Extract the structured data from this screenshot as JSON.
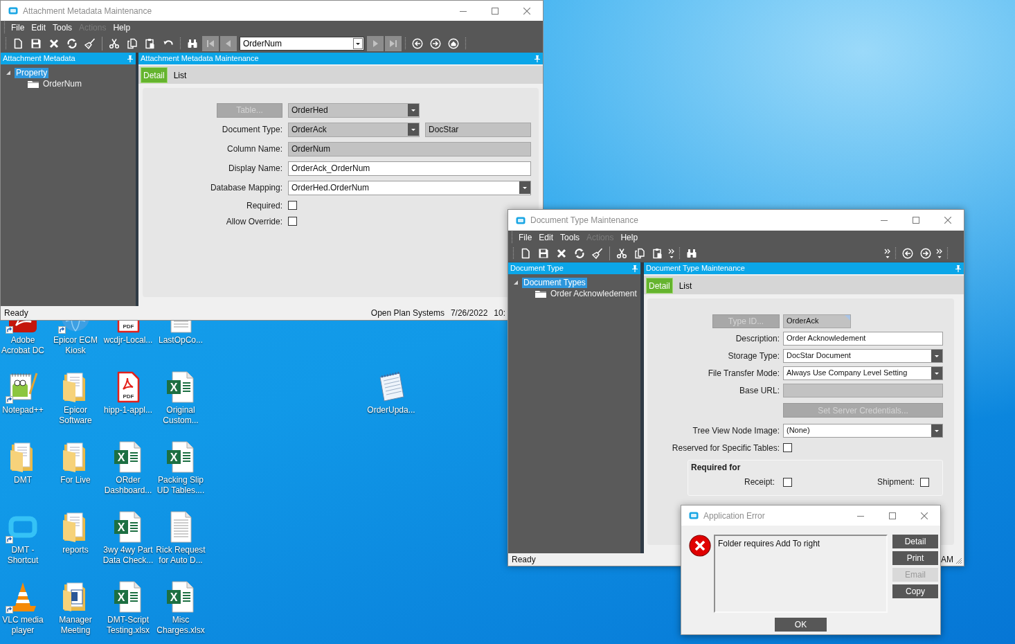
{
  "desktop": {
    "icons": [
      {
        "label": "Adobe Acrobat DC",
        "kind": "acrobat",
        "shortcut": true
      },
      {
        "label": "Epicor ECM Kiosk",
        "kind": "globe",
        "shortcut": true
      },
      {
        "label": "wcdjr-Local...",
        "kind": "pdf",
        "badge": "PDF",
        "shortcut": false
      },
      {
        "label": "LastOpCo...",
        "kind": "text",
        "shortcut": false
      },
      {
        "label": "Notepad++",
        "kind": "notepad",
        "shortcut": true
      },
      {
        "label": "Epicor Software",
        "kind": "folder",
        "shortcut": false
      },
      {
        "label": "hipp-1-appl...",
        "kind": "pdf",
        "badge": "PDF",
        "shortcut": false
      },
      {
        "label": "Original Custom...",
        "kind": "excel",
        "badge": "X",
        "shortcut": false
      },
      {
        "label": "DMT",
        "kind": "folder",
        "shortcut": false
      },
      {
        "label": "For Live",
        "kind": "folder",
        "shortcut": false
      },
      {
        "label": "ORder Dashboard...",
        "kind": "excel",
        "badge": "X",
        "shortcut": false
      },
      {
        "label": "Packing Slip UD Tables....",
        "kind": "excel",
        "badge": "X",
        "shortcut": false
      },
      {
        "label": "DMT - Shortcut",
        "kind": "app",
        "shortcut": true
      },
      {
        "label": "reports",
        "kind": "folder",
        "shortcut": false
      },
      {
        "label": "3wy 4wy Part Data Check...",
        "kind": "excel",
        "badge": "X",
        "shortcut": false
      },
      {
        "label": "Rick Request for Auto D...",
        "kind": "text",
        "shortcut": false
      },
      {
        "label": "VLC media player",
        "kind": "cone",
        "shortcut": true
      },
      {
        "label": "Manager Meeting",
        "kind": "folder_doc",
        "shortcut": false
      },
      {
        "label": "DMT-Script Testing.xlsx",
        "kind": "excel",
        "badge": "X",
        "shortcut": false
      },
      {
        "label": "Misc Charges.xlsx",
        "kind": "excel",
        "badge": "X",
        "shortcut": false
      }
    ],
    "loose_icons": [
      {
        "label": "OrderUpda...",
        "kind": "notepad_doc",
        "shortcut": false
      }
    ]
  },
  "attachment_window": {
    "title": "Attachment Metadata Maintenance",
    "menu": [
      {
        "label": "File",
        "disabled": false
      },
      {
        "label": "Edit",
        "disabled": false
      },
      {
        "label": "Tools",
        "disabled": false
      },
      {
        "label": "Actions",
        "disabled": true
      },
      {
        "label": "Help",
        "disabled": false
      }
    ],
    "toolbar": [
      {
        "kind": "grip"
      },
      {
        "kind": "new",
        "disabled": false
      },
      {
        "kind": "save",
        "disabled": false
      },
      {
        "kind": "delete",
        "disabled": false
      },
      {
        "kind": "refresh",
        "disabled": false
      },
      {
        "kind": "clear",
        "disabled": false
      },
      {
        "kind": "separator"
      },
      {
        "kind": "cut",
        "disabled": false
      },
      {
        "kind": "copy",
        "disabled": false
      },
      {
        "kind": "paste",
        "disabled": false
      },
      {
        "kind": "undo",
        "disabled": false
      },
      {
        "kind": "grip"
      },
      {
        "kind": "find",
        "disabled": false
      },
      {
        "kind": "first",
        "disabled": true
      },
      {
        "kind": "prev",
        "disabled": true
      },
      {
        "kind": "combo",
        "value": "OrderNum"
      },
      {
        "kind": "next",
        "disabled": true
      },
      {
        "kind": "last",
        "disabled": true
      },
      {
        "kind": "grip"
      },
      {
        "kind": "back",
        "disabled": false
      },
      {
        "kind": "forward",
        "disabled": false
      },
      {
        "kind": "home",
        "disabled": false
      },
      {
        "kind": "grip"
      }
    ],
    "tree_pane": {
      "title": "Attachment Metadata",
      "tree": [
        {
          "label": "Property",
          "selected": true,
          "expanded": true,
          "children": [
            {
              "label": "OrderNum",
              "selected": false
            }
          ]
        }
      ]
    },
    "main_pane": {
      "title": "Attachment Metadata Maintenance",
      "tabs": [
        {
          "label": "Detail",
          "selected": true
        },
        {
          "label": "List",
          "selected": false
        }
      ],
      "form": {
        "rows": [
          {
            "kind": "button_field",
            "button": {
              "label": "Table...",
              "disabled": true
            },
            "fields": [
              {
                "kind": "dropdown",
                "value": "OrderHed",
                "readonly": true,
                "flagged": false
              }
            ]
          },
          {
            "kind": "field",
            "label": "Document Type:",
            "fields": [
              {
                "kind": "dropdown",
                "value": "OrderAck",
                "readonly": true,
                "flagged": false
              },
              {
                "kind": "text",
                "value": "DocStar",
                "readonly": true,
                "flagged": false
              }
            ]
          },
          {
            "kind": "field",
            "label": "Column Name:",
            "fields": [
              {
                "kind": "text",
                "value": "OrderNum",
                "readonly": true,
                "flagged": false
              }
            ]
          },
          {
            "kind": "field",
            "label": "Display Name:",
            "fields": [
              {
                "kind": "text",
                "value": "OrderAck_OrderNum",
                "readonly": false,
                "flagged": false
              }
            ]
          },
          {
            "kind": "field",
            "label": "Database Mapping:",
            "fields": [
              {
                "kind": "dropdown",
                "value": "OrderHed.OrderNum",
                "readonly": false,
                "flagged": false
              }
            ]
          },
          {
            "kind": "checkbox",
            "label": "Required:",
            "checked": false
          },
          {
            "kind": "checkbox",
            "label": "Allow Override:",
            "checked": false
          }
        ]
      }
    },
    "status_bar": {
      "text": "Ready",
      "items": [
        "Open Plan Systems",
        "7/26/2022",
        "10:"
      ]
    }
  },
  "doctype_window": {
    "title": "Document Type Maintenance",
    "menu": [
      {
        "label": "File",
        "disabled": false
      },
      {
        "label": "Edit",
        "disabled": false
      },
      {
        "label": "Tools",
        "disabled": false
      },
      {
        "label": "Actions",
        "disabled": true
      },
      {
        "label": "Help",
        "disabled": false
      }
    ],
    "toolbar": [
      {
        "kind": "grip"
      },
      {
        "kind": "new",
        "disabled": false
      },
      {
        "kind": "save",
        "disabled": false
      },
      {
        "kind": "delete",
        "disabled": false
      },
      {
        "kind": "refresh",
        "disabled": false
      },
      {
        "kind": "clear",
        "disabled": false
      },
      {
        "kind": "separator"
      },
      {
        "kind": "cut",
        "disabled": false
      },
      {
        "kind": "copy",
        "disabled": false
      },
      {
        "kind": "paste",
        "disabled": false
      },
      {
        "kind": "overflow",
        "disabled": false
      },
      {
        "kind": "grip"
      },
      {
        "kind": "find",
        "disabled": false
      }
    ],
    "toolbar_right": [
      {
        "kind": "overflow",
        "disabled": false
      },
      {
        "kind": "grip"
      },
      {
        "kind": "back",
        "disabled": false
      },
      {
        "kind": "forward",
        "disabled": false
      },
      {
        "kind": "overflow",
        "disabled": false
      },
      {
        "kind": "grip"
      }
    ],
    "tree_pane": {
      "title": "Document Type",
      "tree": [
        {
          "label": "Document Types",
          "selected": true,
          "expanded": true,
          "children": [
            {
              "label": "Order Acknowledement",
              "selected": false
            }
          ]
        }
      ]
    },
    "main_pane": {
      "title": "Document Type Maintenance",
      "tabs": [
        {
          "label": "Detail",
          "selected": true
        },
        {
          "label": "List",
          "selected": false
        }
      ],
      "form": {
        "rows": [
          {
            "kind": "button_field",
            "button": {
              "label": "Type ID...",
              "disabled": true
            },
            "fields": [
              {
                "kind": "text",
                "value": "OrderAck",
                "readonly": true,
                "flagged": true
              }
            ]
          },
          {
            "kind": "field",
            "label": "Description:",
            "fields": [
              {
                "kind": "text",
                "value": "Order Acknowledement",
                "readonly": false,
                "flagged": false
              }
            ]
          },
          {
            "kind": "field",
            "label": "Storage Type:",
            "fields": [
              {
                "kind": "dropdown",
                "value": "DocStar Document",
                "readonly": false,
                "flagged": false
              }
            ]
          },
          {
            "kind": "field",
            "label": "File Transfer Mode:",
            "fields": [
              {
                "kind": "dropdown",
                "value": "Always Use Company Level Setting",
                "readonly": false,
                "flagged": false
              }
            ]
          },
          {
            "kind": "field",
            "label": "Base URL:",
            "fields": [
              {
                "kind": "text",
                "readonly": true,
                "flagged": false
              }
            ]
          },
          {
            "kind": "button",
            "button": {
              "label": "Set Server Credentials...",
              "disabled": true
            }
          },
          {
            "kind": "field",
            "label": "Tree View Node Image:",
            "fields": [
              {
                "kind": "dropdown",
                "value": "(None)",
                "readonly": false,
                "flagged": false
              }
            ]
          },
          {
            "kind": "checkbox",
            "label": "Reserved for Specific Tables:",
            "checked": false
          },
          {
            "kind": "group",
            "title": "Required for",
            "items": [
              {
                "label": "Receipt:",
                "checked": false
              },
              {
                "label": "Shipment:",
                "checked": false
              }
            ]
          }
        ]
      }
    },
    "status_bar": {
      "text": "Ready",
      "items": [
        "AM"
      ]
    }
  },
  "error_dialog": {
    "title": "Application Error",
    "message": "Folder requires Add To right",
    "buttons": [
      {
        "label": "Detail",
        "disabled": false
      },
      {
        "label": "Print",
        "disabled": false
      },
      {
        "label": "Email",
        "disabled": true
      },
      {
        "label": "Copy",
        "disabled": false
      }
    ],
    "ok": "OK"
  }
}
